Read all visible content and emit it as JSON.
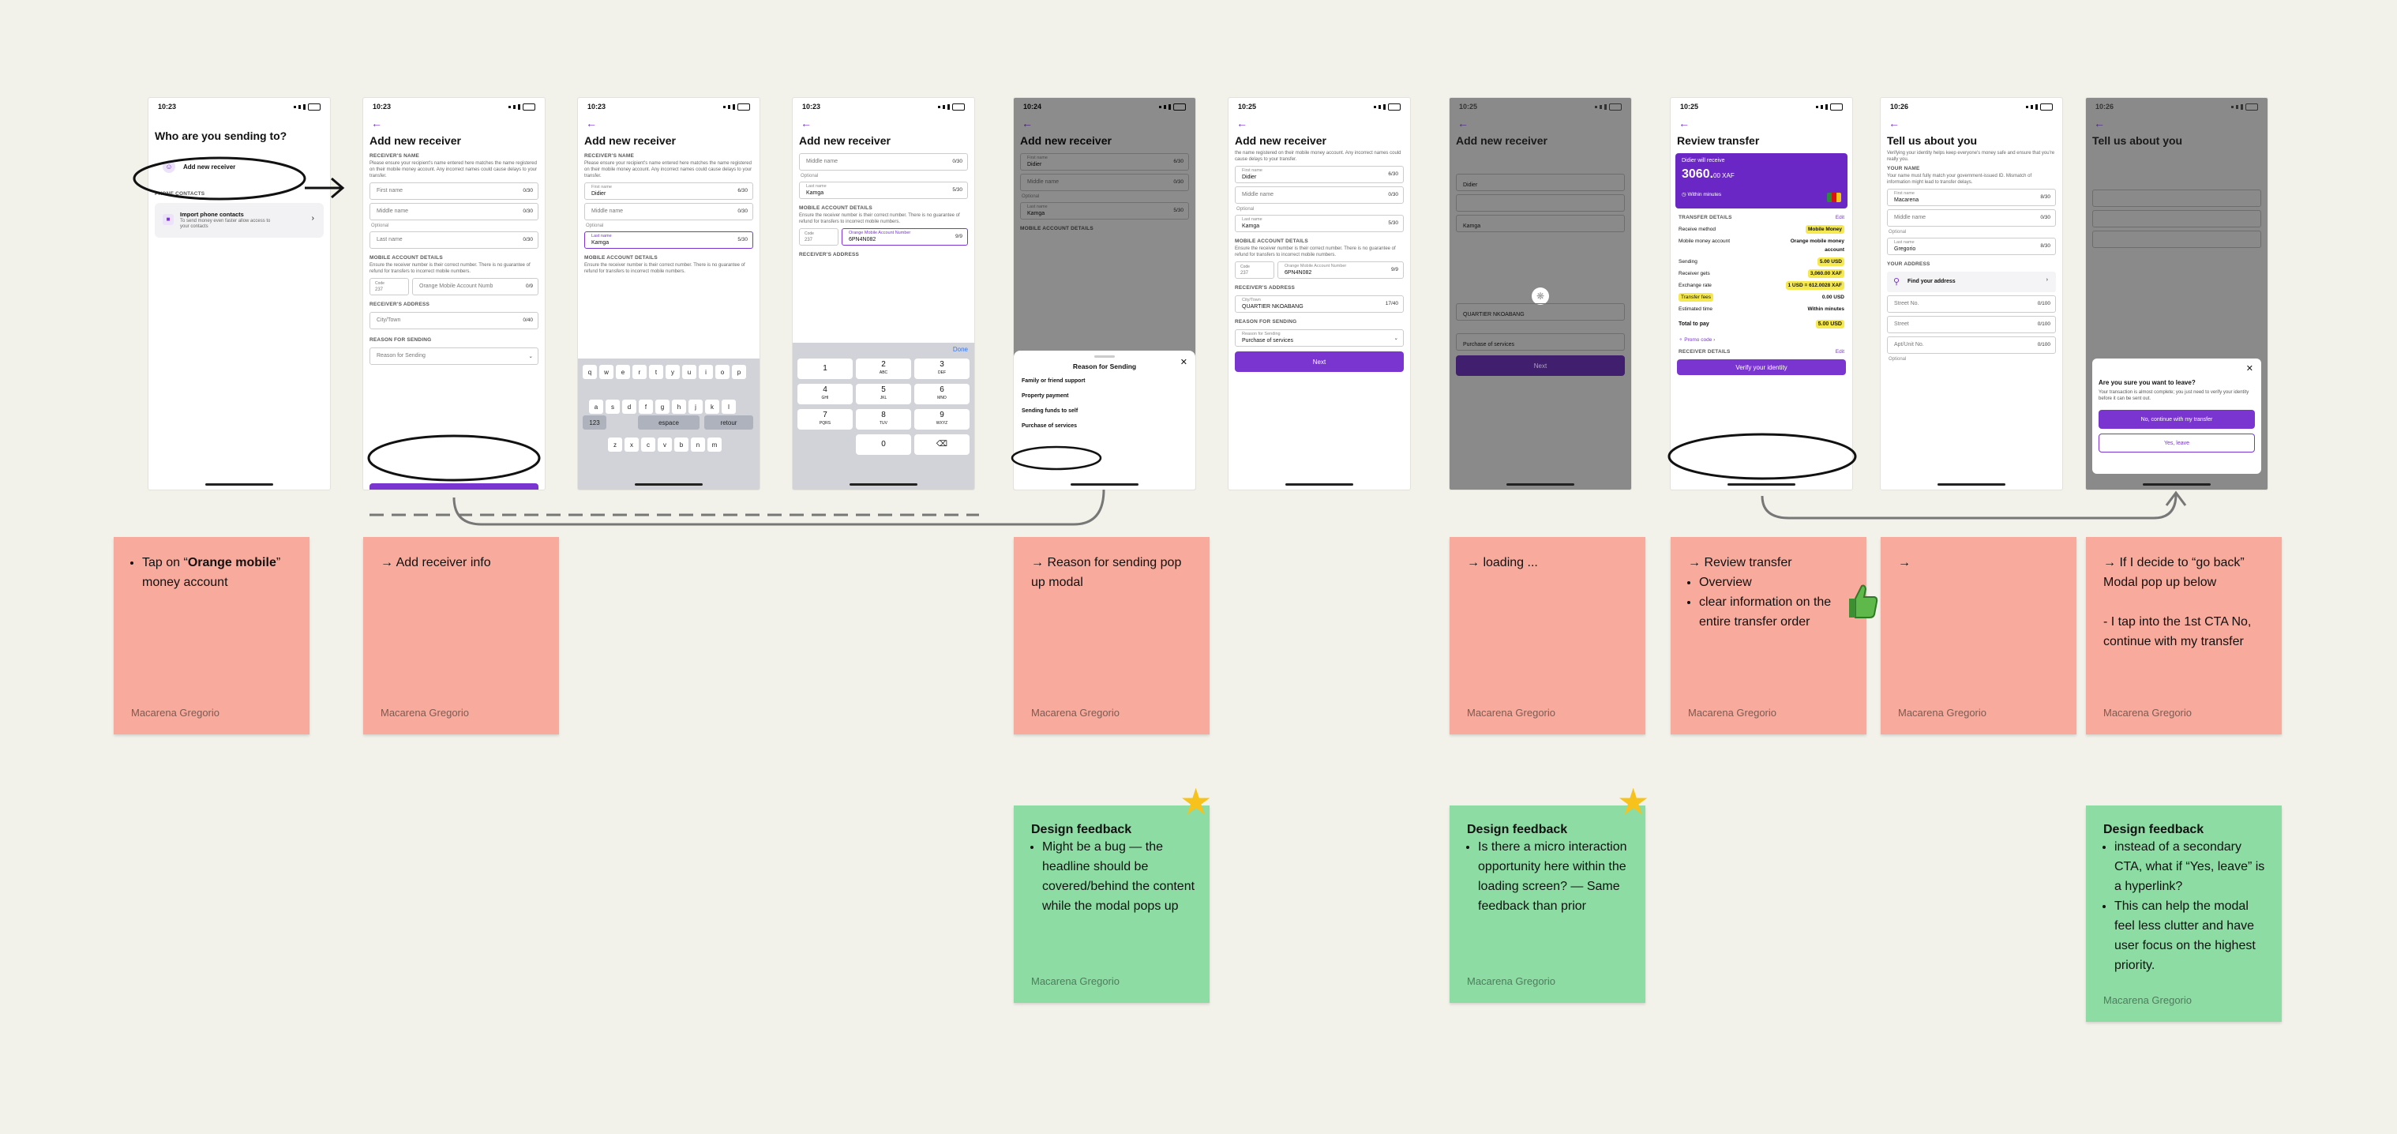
{
  "s1": {
    "time": "10:23",
    "title": "Who are you sending to?",
    "add_receiver": "Add new receiver",
    "phone_contacts": "PHONE CONTACTS",
    "import_title": "Import phone contacts",
    "import_desc": "To send money even faster allow access to your contacts"
  },
  "s2": {
    "time": "10:23",
    "title": "Add new receiver",
    "receivers_name": "RECEIVER'S NAME",
    "name_desc": "Please ensure your recipient's name entered here matches the name registered on their mobile money account. Any incorrect names could cause delays to your transfer.",
    "first_name": "First name",
    "first_count": "0/30",
    "middle_name": "Middle name",
    "middle_count": "0/30",
    "optional": "Optional",
    "last_name": "Last name",
    "last_count": "0/30",
    "mobile_details": "MOBILE ACCOUNT DETAILS",
    "mobile_desc": "Ensure the receiver number is their correct number. There is no guarantee of refund for transfers to incorrect mobile numbers.",
    "code_label": "Code",
    "code_value": "237",
    "mobile_number": "Orange Mobile Account Numb",
    "mobile_count": "0/9",
    "address": "RECEIVER'S ADDRESS",
    "city": "City/Town",
    "city_count": "0/40",
    "reason_label": "REASON FOR SENDING",
    "reason_ph": "Reason for Sending"
  },
  "s3": {
    "time": "10:23",
    "title": "Add new receiver",
    "receivers_name": "RECEIVER'S NAME",
    "name_desc": "Please ensure your recipient's name entered here matches the name registered on their mobile money account. Any incorrect names could cause delays to your transfer.",
    "first_label": "First name",
    "first_value": "Didier",
    "first_count": "6/30",
    "middle_name": "Middle name",
    "middle_count": "0/30",
    "optional": "Optional",
    "last_label": "Last name",
    "last_value": "Kamga",
    "last_count": "5/30",
    "mobile_details": "MOBILE ACCOUNT DETAILS",
    "mobile_desc": "Ensure the receiver number is their correct number. There is no guarantee of refund for transfers to incorrect mobile numbers.",
    "code_label": "Code",
    "mobile_number": "Orange Mobile Account Numb",
    "mobile_count": "0/9",
    "kb_row1": [
      "q",
      "w",
      "e",
      "r",
      "t",
      "y",
      "u",
      "i",
      "o",
      "p"
    ],
    "kb_row2": [
      "a",
      "s",
      "d",
      "f",
      "g",
      "h",
      "j",
      "k",
      "l"
    ],
    "kb_row3": [
      "z",
      "x",
      "c",
      "v",
      "b",
      "n",
      "m"
    ],
    "kb_num": "123",
    "kb_space": "espace",
    "kb_return": "retour"
  },
  "s4": {
    "time": "10:23",
    "title": "Add new receiver",
    "middle_name": "Middle name",
    "middle_count": "0/30",
    "optional": "Optional",
    "last_label": "Last name",
    "last_value": "Kamga",
    "last_count": "5/30",
    "mobile_details": "MOBILE ACCOUNT DETAILS",
    "mobile_desc": "Ensure the receiver number is their correct number. There is no guarantee of refund for transfers to incorrect mobile numbers.",
    "code_label": "Code",
    "code_value": "237",
    "mobile_label": "Orange Mobile Account Number",
    "mobile_value": "6PN4N082",
    "mobile_count": "9/9",
    "address": "RECEIVER'S ADDRESS",
    "city": "City/Town",
    "city_count": "0/40",
    "done": "Done",
    "np": [
      [
        "1",
        ""
      ],
      [
        "2",
        "ABC"
      ],
      [
        "3",
        "DEF"
      ],
      [
        "4",
        "GHI"
      ],
      [
        "5",
        "JKL"
      ],
      [
        "6",
        "MNO"
      ],
      [
        "7",
        "PQRS"
      ],
      [
        "8",
        "TUV"
      ],
      [
        "9",
        "WXYZ"
      ],
      [
        "",
        ""
      ],
      [
        "0",
        ""
      ],
      [
        "⌫",
        ""
      ]
    ]
  },
  "s5": {
    "time": "10:24",
    "title": "Add new receiver",
    "first_label": "First name",
    "first_value": "Didier",
    "first_count": "6/30",
    "middle_name": "Middle name",
    "middle_count": "0/30",
    "optional": "Optional",
    "last_label": "Last name",
    "last_value": "Kamga",
    "last_count": "5/30",
    "mobile_details": "MOBILE ACCOUNT DETAILS",
    "sheet_title": "Reason for Sending",
    "reasons": [
      "Family or friend support",
      "Property payment",
      "Sending funds to self",
      "Purchase of services"
    ]
  },
  "s6": {
    "time": "10:25",
    "title": "Add new receiver",
    "name_desc": "the name registered on their mobile money account. Any incorrect names could cause delays to your transfer.",
    "first_label": "First name",
    "first_value": "Didier",
    "first_count": "6/30",
    "middle_name": "Middle name",
    "middle_count": "0/30",
    "optional": "Optional",
    "last_label": "Last name",
    "last_value": "Kamga",
    "last_count": "5/30",
    "mobile_details": "MOBILE ACCOUNT DETAILS",
    "mobile_desc": "Ensure the receiver number is their correct number. There is no guarantee of refund for transfers to incorrect mobile numbers.",
    "code_label": "Code",
    "code_value": "237",
    "mobile_label": "Orange Mobile Account Number",
    "mobile_value": "6PN4N082",
    "mobile_count": "9/9",
    "address": "RECEIVER'S ADDRESS",
    "city_label": "City/Town",
    "city_value": "QUARTIER NKOABANG",
    "city_count": "17/40",
    "reason_label": "REASON FOR SENDING",
    "reason_small": "Reason for Sending",
    "reason_value": "Purchase of services",
    "next": "Next"
  },
  "s7": {
    "time": "10:25",
    "title": "Add new receiver",
    "first_value": "Didier",
    "last_value": "Kamga",
    "city_value": "QUARTIER NKOABANG",
    "reason_value": "Purchase of services",
    "next": "Next"
  },
  "s8": {
    "time": "10:25",
    "title": "Review transfer",
    "will_receive": "Didier will receive",
    "amount": "3060.",
    "amount_dec": "00 XAF",
    "within": "Within minutes",
    "transfer_details": "TRANSFER DETAILS",
    "edit": "Edit",
    "rows": [
      [
        "Receive method",
        "Mobile Money"
      ],
      [
        "Mobile money account",
        "Orange mobile money account"
      ],
      [
        "Sending",
        "5.00 USD"
      ],
      [
        "Receiver gets",
        "3,060.00 XAF"
      ],
      [
        "Exchange rate",
        "1 USD = 612.0028 XAF"
      ],
      [
        "Transfer fees",
        "0.00 USD"
      ],
      [
        "Estimated time",
        "Within minutes"
      ]
    ],
    "total_label": "Total to pay",
    "total_value": "5.00 USD",
    "promo": "Promo code",
    "receiver_details": "RECEIVER DETAILS",
    "verify": "Verify your identity"
  },
  "s9": {
    "time": "10:26",
    "title": "Tell us about you",
    "desc": "Verifying your identity helps keep everyone's money safe and ensure that you're really you.",
    "your_name": "YOUR NAME",
    "name_desc": "Your name must fully match your government-issued ID. Mismatch of information might lead to transfer delays.",
    "first_label": "First name",
    "first_value": "Macarena",
    "first_count": "8/30",
    "middle_name": "Middle name",
    "middle_count": "0/30",
    "optional": "Optional",
    "last_label": "Last name",
    "last_value": "Gregorio",
    "last_count": "8/30",
    "your_address": "YOUR ADDRESS",
    "find_address": "Find your address",
    "street_no": "Street No.",
    "street_no_count": "0/100",
    "street": "Street",
    "street_count": "0/100",
    "apt": "Apt/Unit No.",
    "apt_count": "0/100",
    "optional2": "Optional"
  },
  "s10": {
    "time": "10:26",
    "title": "Tell us about you",
    "modal_title": "Are you sure you want to leave?",
    "modal_desc": "Your transaction is almost complete; you just need to verify your identity before it can be sent out.",
    "primary": "No, continue with my transfer",
    "secondary": "Yes, leave"
  },
  "notes": {
    "n1": {
      "pre": "Tap on “",
      "bold": "Orange mobile",
      "post": "” money account",
      "author": "Macarena Gregorio"
    },
    "n2": {
      "text": "→ Add receiver info",
      "author": "Macarena Gregorio"
    },
    "n3": {
      "text": "→ Reason for sending pop up modal",
      "author": "Macarena Gregorio"
    },
    "n4": {
      "text": "→ loading ...",
      "author": "Macarena Gregorio"
    },
    "n5": {
      "head": "→ Review transfer",
      "items": [
        "Overview",
        "clear information on the entire transfer order"
      ],
      "author": "Macarena Gregorio"
    },
    "n6": {
      "text": "→",
      "author": "Macarena Gregorio"
    },
    "n7": {
      "text": "→ If I decide to “go back” Modal pop up below\n\n- I tap into the 1st CTA No, continue with my transfer",
      "author": "Macarena Gregorio"
    },
    "f1": {
      "title": "Design feedback",
      "items": [
        "Might be a bug — the headline should be covered/behind the content while the modal pops up"
      ],
      "author": "Macarena Gregorio"
    },
    "f2": {
      "title": "Design feedback",
      "items": [
        "Is there a micro interaction opportunity here within the loading screen? — Same feedback than prior"
      ],
      "author": "Macarena Gregorio"
    },
    "f3": {
      "title": "Design feedback",
      "items": [
        "instead of a secondary CTA, what if “Yes, leave” is a hyperlink?",
        "This can help the modal feel less clutter and have user focus on the highest priority."
      ],
      "author": "Macarena Gregorio"
    }
  },
  "colors": {
    "background": "#f2f1ea",
    "primary": "#7a35d0",
    "sticky_pink": "#f8ab9c",
    "sticky_green": "#8cdca4",
    "highlight": "#f5e94f",
    "star": "#f6c21b"
  }
}
